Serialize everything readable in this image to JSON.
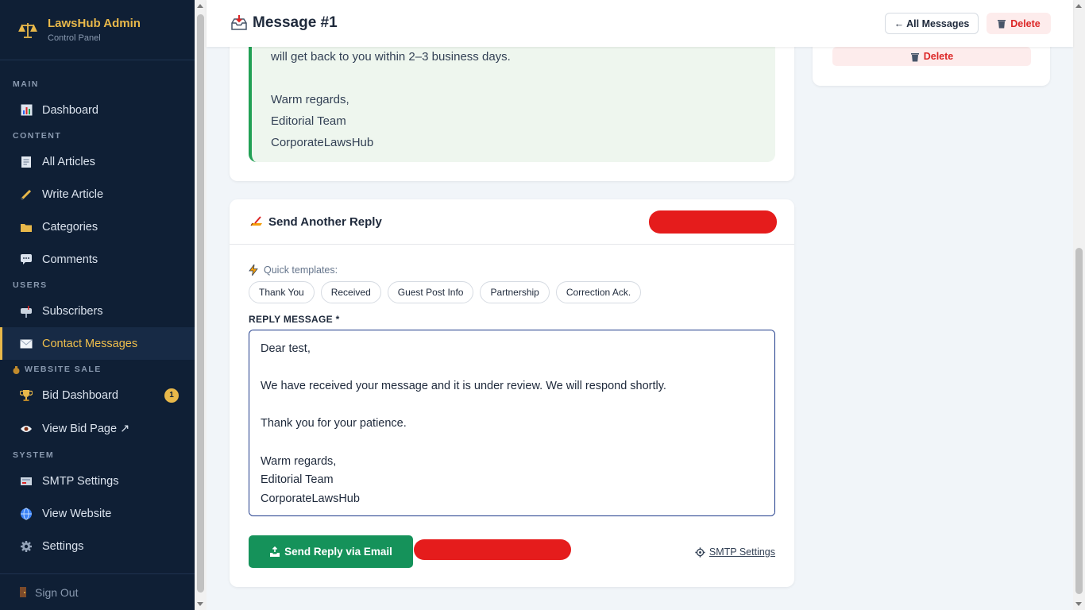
{
  "brand": {
    "title": "LawsHub Admin",
    "subtitle": "Control Panel",
    "icon": "scales-icon"
  },
  "sidebar": {
    "sections": {
      "main": "MAIN",
      "content": "CONTENT",
      "users": "USERS",
      "website_sale": "WEBSITE SALE",
      "system": "SYSTEM"
    },
    "items": {
      "dashboard": {
        "label": "Dashboard",
        "icon": "bar-chart-icon"
      },
      "all_articles": {
        "label": "All Articles",
        "icon": "memo-icon"
      },
      "write_article": {
        "label": "Write Article",
        "icon": "pencil-icon"
      },
      "categories": {
        "label": "Categories",
        "icon": "folder-icon"
      },
      "comments": {
        "label": "Comments",
        "icon": "speech-bubble-icon"
      },
      "subscribers": {
        "label": "Subscribers",
        "icon": "mailbox-icon"
      },
      "contact_messages": {
        "label": "Contact Messages",
        "icon": "envelope-icon",
        "active": true
      },
      "bid_dashboard": {
        "label": "Bid Dashboard",
        "icon": "trophy-icon",
        "badge": "1"
      },
      "view_bid_page": {
        "label": "View Bid Page ↗",
        "icon": "eye-icon"
      },
      "smtp_settings": {
        "label": "SMTP Settings",
        "icon": "mail-server-icon"
      },
      "view_website": {
        "label": "View Website",
        "icon": "globe-icon"
      },
      "settings": {
        "label": "Settings",
        "icon": "gear-icon"
      }
    },
    "sign_out": "Sign Out"
  },
  "header": {
    "title": "Message #1",
    "all_messages_label": "← All Messages",
    "delete_label": "Delete"
  },
  "previous_reply": {
    "lines": [
      "will get back to you within 2–3 business days.",
      "",
      "Warm regards,",
      "Editorial Team",
      "CorporateLawsHub"
    ]
  },
  "side_card": {
    "delete_label": "Delete"
  },
  "reply_form": {
    "title": "Send Another Reply",
    "quick_templates_label": "Quick templates:",
    "templates": [
      "Thank You",
      "Received",
      "Guest Post Info",
      "Partnership",
      "Correction Ack."
    ],
    "field_label": "REPLY MESSAGE *",
    "message": "Dear test,\n\nWe have received your message and it is under review. We will respond shortly.\n\nThank you for your patience.\n\nWarm regards,\nEditorial Team\nCorporateLawsHub",
    "send_label": "Send Reply via Email",
    "smtp_link_label": "SMTP Settings"
  },
  "colors": {
    "sidebar_bg": "#0f1f35",
    "accent_gold": "#e8b84a",
    "send_green": "#15925a",
    "danger_red": "#dc2626",
    "quote_bg": "#eef6ee",
    "redaction": "#e51c1c"
  }
}
